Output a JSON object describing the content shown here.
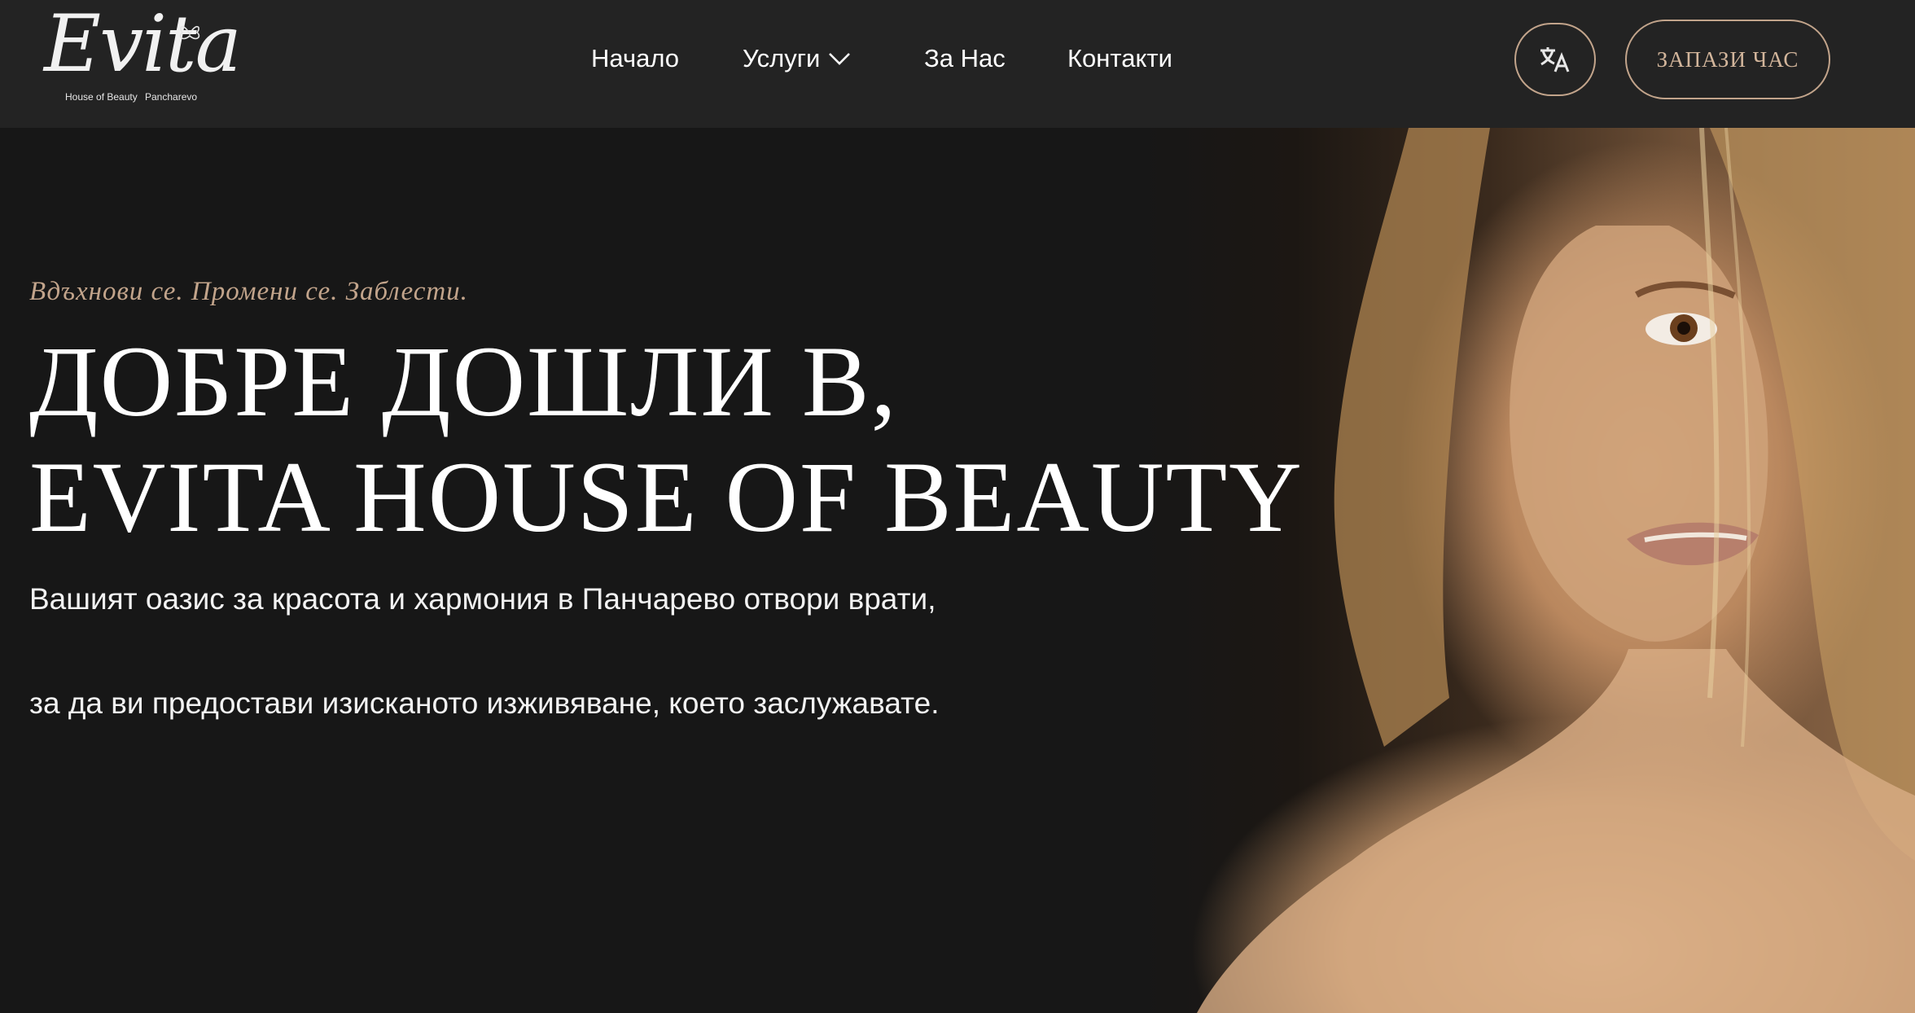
{
  "header": {
    "logo": {
      "script_text": "Evita",
      "sub_left": "House of Beauty",
      "sub_right": "Pancharevo"
    },
    "nav": {
      "home": "Начало",
      "services": "Услуги",
      "about": "За Нас",
      "contacts": "Контакти"
    },
    "language_icon": "translate-icon",
    "book_label": "ЗАПАЗИ ЧАС"
  },
  "hero": {
    "tagline": "Вдъхнови се. Промени се. Заблести.",
    "headline_line1": "ДОБРЕ ДОШЛИ В,",
    "headline_line2": "EVITA HOUSE OF BEAUTY",
    "description_1": "Вашият оазис за красота и хармония в Панчарево отвори врати,",
    "description_2": "за да ви предостави изисканото изживяване, което заслужавате."
  },
  "colors": {
    "background": "#171717",
    "header_background": "#232323",
    "accent": "#c2a48b",
    "text": "#ffffff"
  }
}
